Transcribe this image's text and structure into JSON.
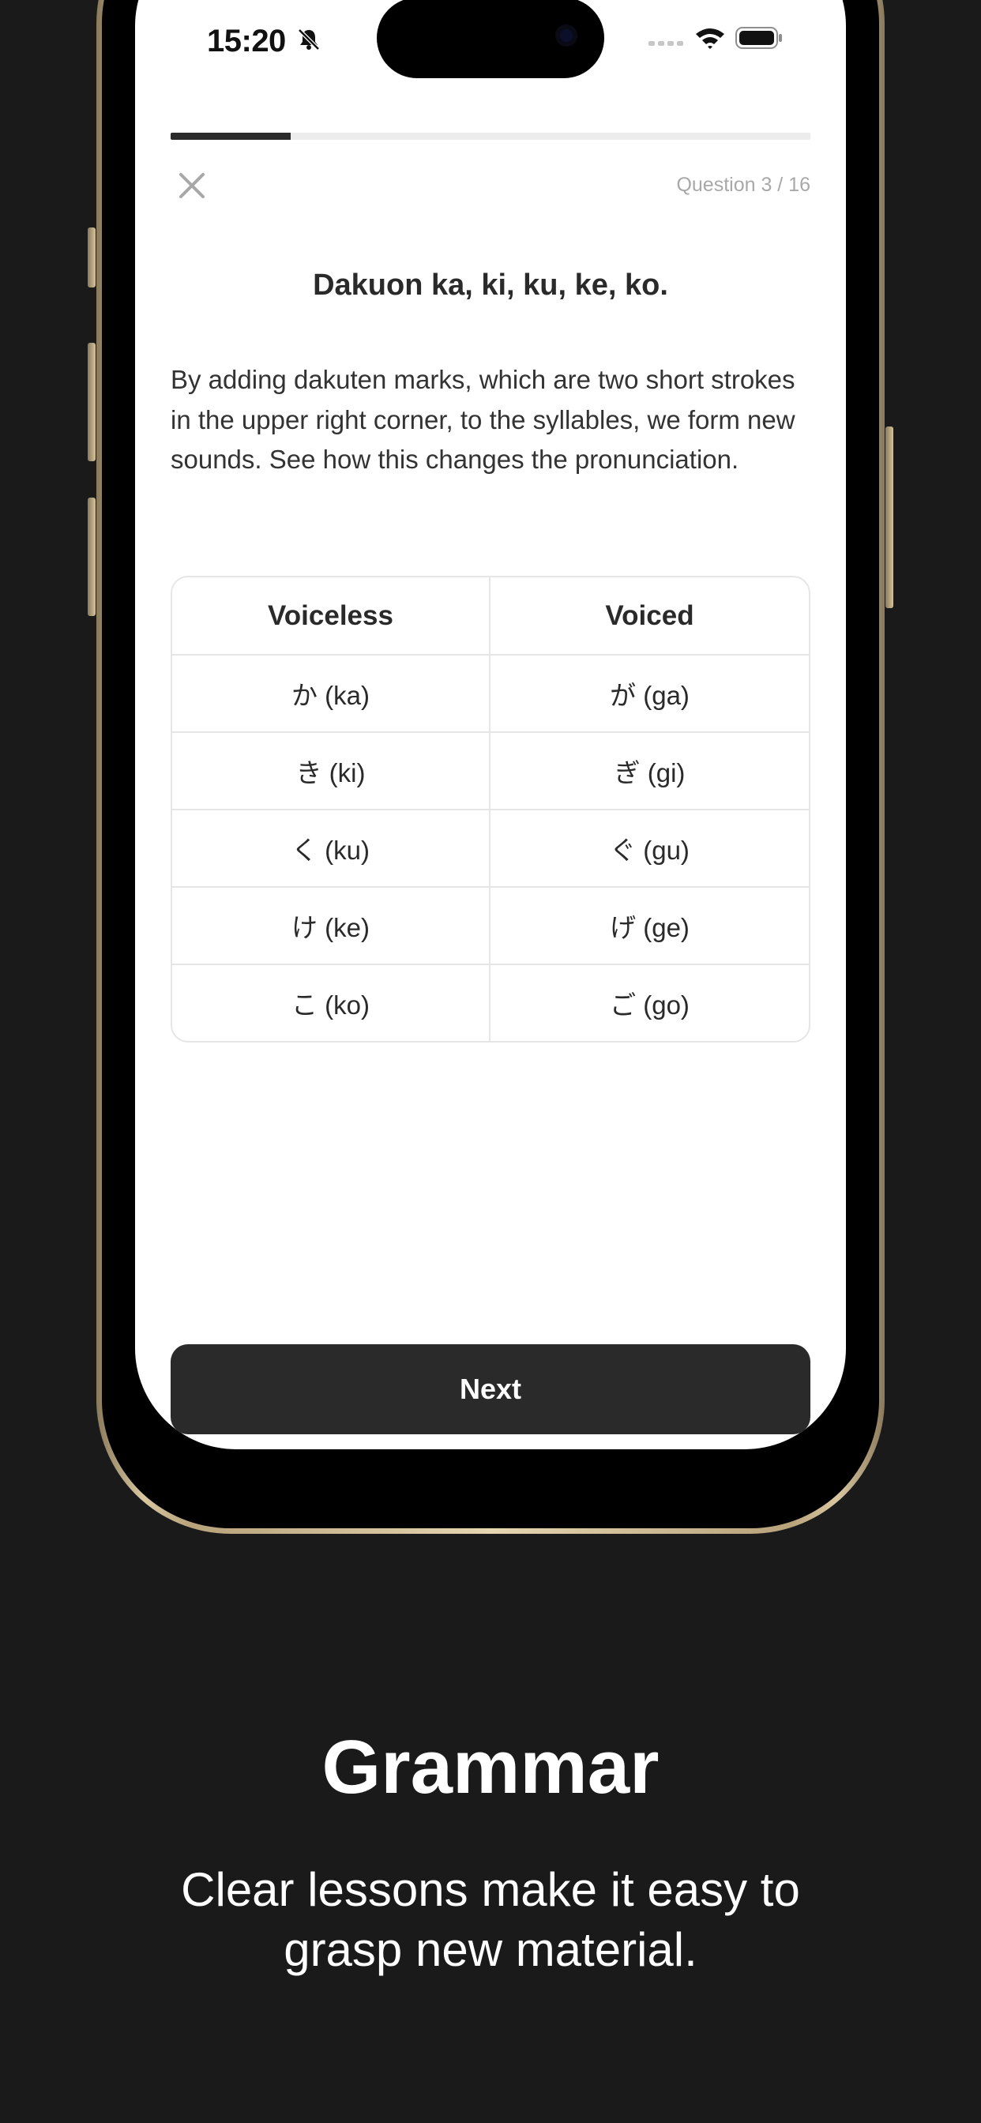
{
  "status_bar": {
    "time": "15:20",
    "icons": [
      "bell-slash-icon",
      "signal-icon",
      "wifi-icon",
      "battery-icon"
    ]
  },
  "quiz": {
    "progress_fraction": 0.1875,
    "counter": "Question 3 / 16",
    "close_icon": "close-icon"
  },
  "lesson": {
    "title": "Dakuon ka, ki, ku, ke, ko.",
    "body": "By adding dakuten marks, which are two short strokes in the upper right corner, to the syllables, we form new sounds. See how this changes the pronunciation.",
    "table": {
      "headers": [
        "Voiceless",
        "Voiced"
      ],
      "rows": [
        [
          "か (ka)",
          "が (ga)"
        ],
        [
          "き (ki)",
          "ぎ (gi)"
        ],
        [
          "く (ku)",
          "ぐ (gu)"
        ],
        [
          "け (ke)",
          "げ (ge)"
        ],
        [
          "こ (ko)",
          "ご (go)"
        ]
      ]
    }
  },
  "actions": {
    "next_label": "Next"
  },
  "promo": {
    "title": "Grammar",
    "subtitle": "Clear lessons make it easy to grasp new material."
  },
  "colors": {
    "background": "#1a1a1a",
    "screen": "#ffffff",
    "button": "#2a2a2a",
    "progress_fill": "#2b2b2b",
    "progress_track": "#ececec",
    "frame_gold": "#d9c7a1"
  }
}
